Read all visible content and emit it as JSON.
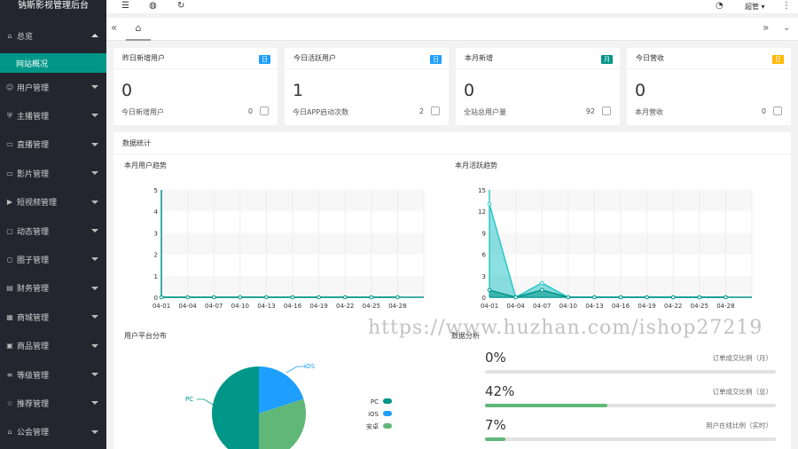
{
  "sidebar": {
    "title": "钠斯影视管理后台",
    "items": [
      {
        "label": "总览",
        "icon": "home-icon",
        "expanded": true
      },
      {
        "label": "用户管理",
        "icon": "user-icon"
      },
      {
        "label": "主播管理",
        "icon": "shield-icon"
      },
      {
        "label": "直播管理",
        "icon": "monitor-icon"
      },
      {
        "label": "影片管理",
        "icon": "film-icon"
      },
      {
        "label": "短视频管理",
        "icon": "play-icon"
      },
      {
        "label": "动态管理",
        "icon": "chat-icon"
      },
      {
        "label": "圈子管理",
        "icon": "circle-icon"
      },
      {
        "label": "财务管理",
        "icon": "wallet-icon"
      },
      {
        "label": "商城管理",
        "icon": "shop-icon"
      },
      {
        "label": "商品管理",
        "icon": "goods-icon"
      },
      {
        "label": "等级管理",
        "icon": "level-icon"
      },
      {
        "label": "推荐管理",
        "icon": "star-icon"
      },
      {
        "label": "公会管理",
        "icon": "guild-icon"
      }
    ],
    "active_sub": "网站概况"
  },
  "topbar": {
    "user": "超管"
  },
  "cards": [
    {
      "title": "昨日新增用户",
      "badge": "日",
      "badge_color": "#1e9fff",
      "value": "0",
      "label": "今日新增用户",
      "count": "0",
      "icon": "user-icon"
    },
    {
      "title": "今日活跃用户",
      "badge": "日",
      "badge_color": "#1e9fff",
      "value": "1",
      "label": "今日APP启动次数",
      "count": "2",
      "icon": "phone-icon"
    },
    {
      "title": "本月新增",
      "badge": "月",
      "badge_color": "#009688",
      "value": "0",
      "label": "全站总用户量",
      "count": "92",
      "icon": "users-icon"
    },
    {
      "title": "今日营收",
      "badge": "日",
      "badge_color": "#ffb800",
      "value": "0",
      "label": "本月营收",
      "count": "0",
      "icon": "coin-icon"
    }
  ],
  "stats_title": "数据统计",
  "chart_data": [
    {
      "type": "line",
      "title": "本月用户趋势",
      "x": [
        "04-01",
        "04-04",
        "04-07",
        "04-10",
        "04-13",
        "04-16",
        "04-19",
        "04-22",
        "04-25",
        "04-28"
      ],
      "y_ticks": [
        "0",
        "1",
        "2",
        "3",
        "4",
        "5"
      ],
      "ylim": [
        0,
        5
      ],
      "series": [
        {
          "values": [
            0,
            0,
            0,
            0,
            0,
            0,
            0,
            0,
            0,
            0
          ]
        }
      ],
      "color": "#009688"
    },
    {
      "type": "area",
      "title": "本月活跃趋势",
      "x": [
        "04-01",
        "04-04",
        "04-07",
        "04-10",
        "04-13",
        "04-16",
        "04-19",
        "04-22",
        "04-25",
        "04-28"
      ],
      "y_ticks": [
        "0",
        "3",
        "6",
        "9",
        "12",
        "15"
      ],
      "ylim": [
        0,
        15
      ],
      "series": [
        {
          "values": [
            13,
            0,
            2,
            0,
            0,
            0,
            0,
            0,
            0,
            0
          ],
          "color": "#2ec7c9"
        },
        {
          "values": [
            1,
            0,
            1,
            0,
            0,
            0,
            0,
            0,
            0,
            0
          ],
          "color": "#009688"
        }
      ]
    },
    {
      "type": "pie",
      "title": "用户平台分布",
      "slices": [
        {
          "label": "PC",
          "value": 50,
          "color": "#009688"
        },
        {
          "label": "iOS",
          "value": 20,
          "color": "#1e9fff"
        },
        {
          "label": "安卓",
          "value": 30,
          "color": "#5fb878"
        }
      ]
    }
  ],
  "analysis": {
    "title": "数据分析",
    "rows": [
      {
        "value": "0%",
        "label": "订单成交比例（月）",
        "percent": 0
      },
      {
        "value": "42%",
        "label": "订单成交比例（总）",
        "percent": 42
      },
      {
        "value": "7%",
        "label": "用户在线比例（实时）",
        "percent": 7
      }
    ]
  },
  "watermark": "https://www.huzhan.com/ishop27219"
}
